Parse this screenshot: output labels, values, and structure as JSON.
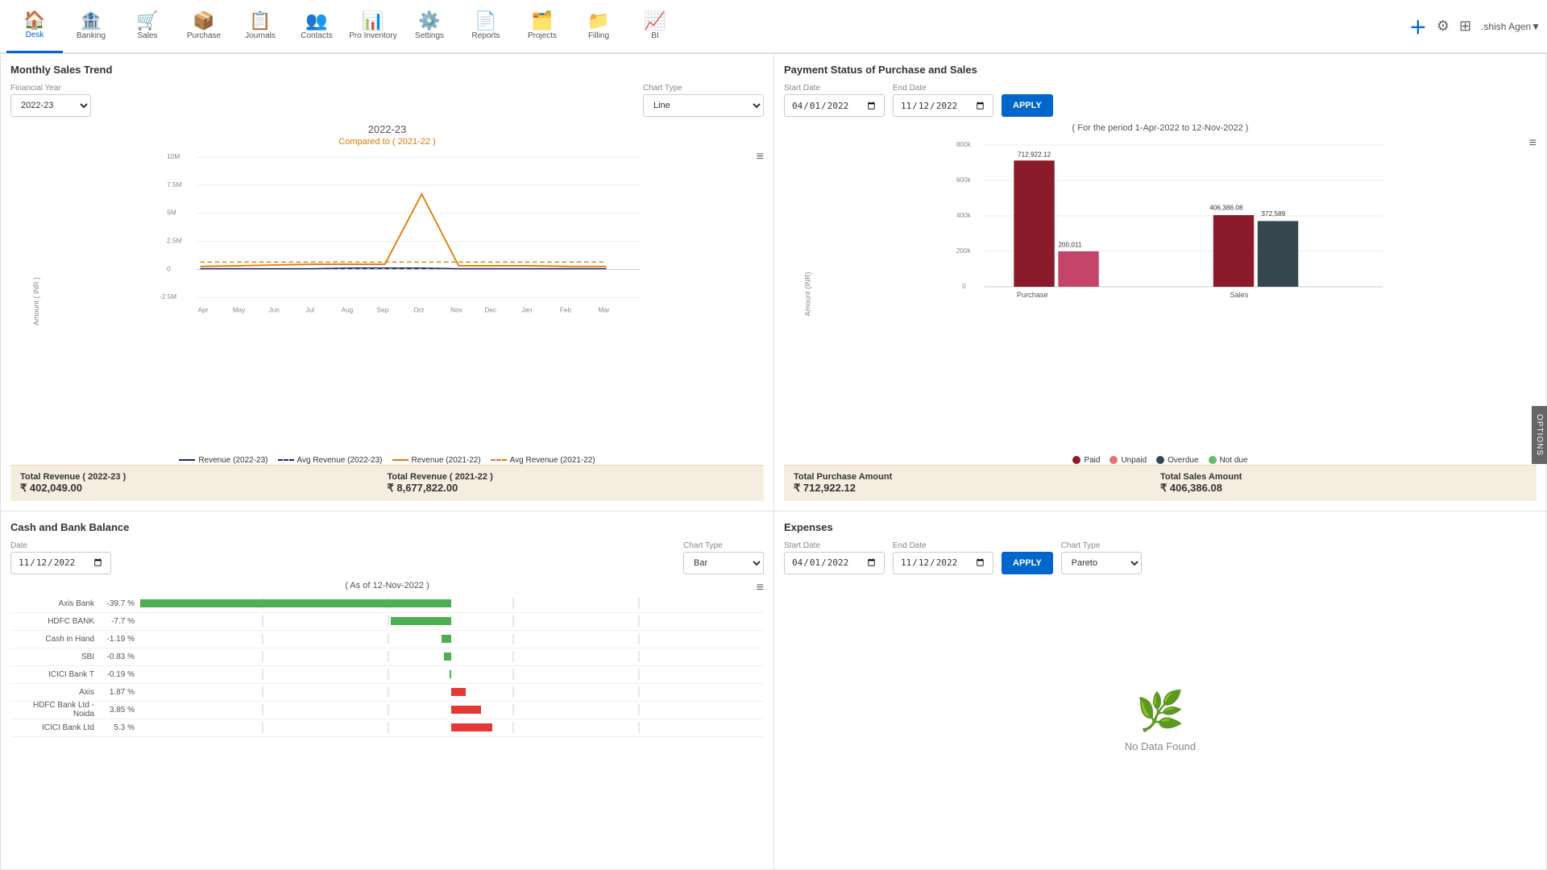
{
  "nav": {
    "items": [
      {
        "id": "desk",
        "label": "Desk",
        "icon": "🏠",
        "active": true
      },
      {
        "id": "banking",
        "label": "Banking",
        "icon": "🏦",
        "active": false
      },
      {
        "id": "sales",
        "label": "Sales",
        "icon": "🛒",
        "active": false
      },
      {
        "id": "purchase",
        "label": "Purchase",
        "icon": "📦",
        "active": false
      },
      {
        "id": "journals",
        "label": "Journals",
        "icon": "📋",
        "active": false
      },
      {
        "id": "contacts",
        "label": "Contacts",
        "icon": "👥",
        "active": false
      },
      {
        "id": "pro-inventory",
        "label": "Pro Inventory",
        "icon": "📊",
        "active": false
      },
      {
        "id": "settings",
        "label": "Settings",
        "icon": "⚙️",
        "active": false
      },
      {
        "id": "reports",
        "label": "Reports",
        "icon": "📄",
        "active": false
      },
      {
        "id": "projects",
        "label": "Projects",
        "icon": "🗂️",
        "active": false
      },
      {
        "id": "filling",
        "label": "Filling",
        "icon": "📁",
        "active": false
      },
      {
        "id": "bi",
        "label": "BI",
        "icon": "📈",
        "active": false
      }
    ],
    "user": ".shish Agen▼"
  },
  "options_tab": "OPTIONS",
  "monthly_sales": {
    "title": "Monthly Sales Trend",
    "financial_year_label": "Financial Year",
    "financial_year_value": "2022-23",
    "chart_type_label": "Chart Type",
    "chart_type_value": "Line",
    "chart_title": "2022-23",
    "chart_subtitle": "Compared to ( 2021-22 )",
    "legend": [
      {
        "label": "Revenue (2022-23)",
        "style": "solid",
        "color": "#1a237e"
      },
      {
        "label": "Avg Revenue (2022-23)",
        "style": "dash",
        "color": "#1a237e"
      },
      {
        "label": "Revenue (2021-22)",
        "style": "solid",
        "color": "#e07b00"
      },
      {
        "label": "Avg Revenue (2021-22)",
        "style": "dash",
        "color": "#e07b00"
      }
    ],
    "x_labels": [
      "Apr",
      "May",
      "Jun",
      "Jul",
      "Aug",
      "Sep",
      "Oct",
      "Nov",
      "Dec",
      "Jan",
      "Feb",
      "Mar"
    ],
    "y_labels": [
      "10M",
      "7.5M",
      "5M",
      "2.5M",
      "0",
      "-2.5M"
    ],
    "y_axis_label": "Amount ( INR )",
    "total_revenue_2022_label": "Total Revenue ( 2022-23 )",
    "total_revenue_2022_value": "₹ 402,049.00",
    "total_revenue_2021_label": "Total Revenue ( 2021-22 )",
    "total_revenue_2021_value": "₹ 8,677,822.00"
  },
  "payment_status": {
    "title": "Payment Status of Purchase and Sales",
    "start_date_label": "Start Date",
    "start_date_value": "01/04/2022",
    "end_date_label": "End Date",
    "end_date_value": "12/11/2022",
    "apply_label": "APPLY",
    "period_note": "( For the period 1-Apr-2022 to 12-Nov-2022 )",
    "y_labels": [
      "800k",
      "600k",
      "400k",
      "200k",
      "0"
    ],
    "y_axis_label": "Amount (INR)",
    "categories": [
      "Purchase",
      "Sales"
    ],
    "bars": {
      "purchase": {
        "paid": 712922.12,
        "paid_label": "712,922.12",
        "unpaid": 200011,
        "unpaid_label": "200,011"
      },
      "sales": {
        "paid": 406386.08,
        "paid_label": "406,386.08",
        "unpaid": 372589,
        "unpaid_label": "372,589"
      }
    },
    "legend": [
      {
        "label": "Paid",
        "color": "#8b1a2a"
      },
      {
        "label": "Unpaid",
        "color": "#e57373"
      },
      {
        "label": "Overdue",
        "color": "#37474f"
      },
      {
        "label": "Not due",
        "color": "#66bb6a"
      }
    ],
    "total_purchase_label": "Total Purchase Amount",
    "total_purchase_value": "₹ 712,922.12",
    "total_sales_label": "Total Sales Amount",
    "total_sales_value": "₹ 406,386.08"
  },
  "cash_bank": {
    "title": "Cash and Bank Balance",
    "date_label": "Date",
    "date_value": "12/11/2022",
    "chart_type_label": "Chart Type",
    "chart_type_value": "Bar",
    "as_of_label": "( As of 12-Nov-2022 )",
    "rows": [
      {
        "label": "Axis Bank",
        "pct": "-39.7 %",
        "val": -39.7
      },
      {
        "label": "HDFC BANK",
        "pct": "-7.7 %",
        "val": -7.7
      },
      {
        "label": "Cash in Hand",
        "pct": "-1.19 %",
        "val": -1.19
      },
      {
        "label": "SBI",
        "pct": "-0.83 %",
        "val": -0.83
      },
      {
        "label": "ICICI Bank T",
        "pct": "-0.19 %",
        "val": -0.19
      },
      {
        "label": "Axis",
        "pct": "1.87 %",
        "val": 1.87
      },
      {
        "label": "HDFC Bank Ltd - Noida",
        "pct": "3.85 %",
        "val": 3.85
      },
      {
        "label": "ICICI Bank Ltd",
        "pct": "5.3 %",
        "val": 5.3
      }
    ]
  },
  "expenses": {
    "title": "Expenses",
    "start_date_label": "Start Date",
    "start_date_value": "01/04/2022",
    "end_date_label": "End Date",
    "end_date_value": "12/11/2022",
    "apply_label": "APPLY",
    "chart_type_label": "Chart Type",
    "chart_type_value": "Pareto",
    "no_data_text": "No Data Found"
  }
}
